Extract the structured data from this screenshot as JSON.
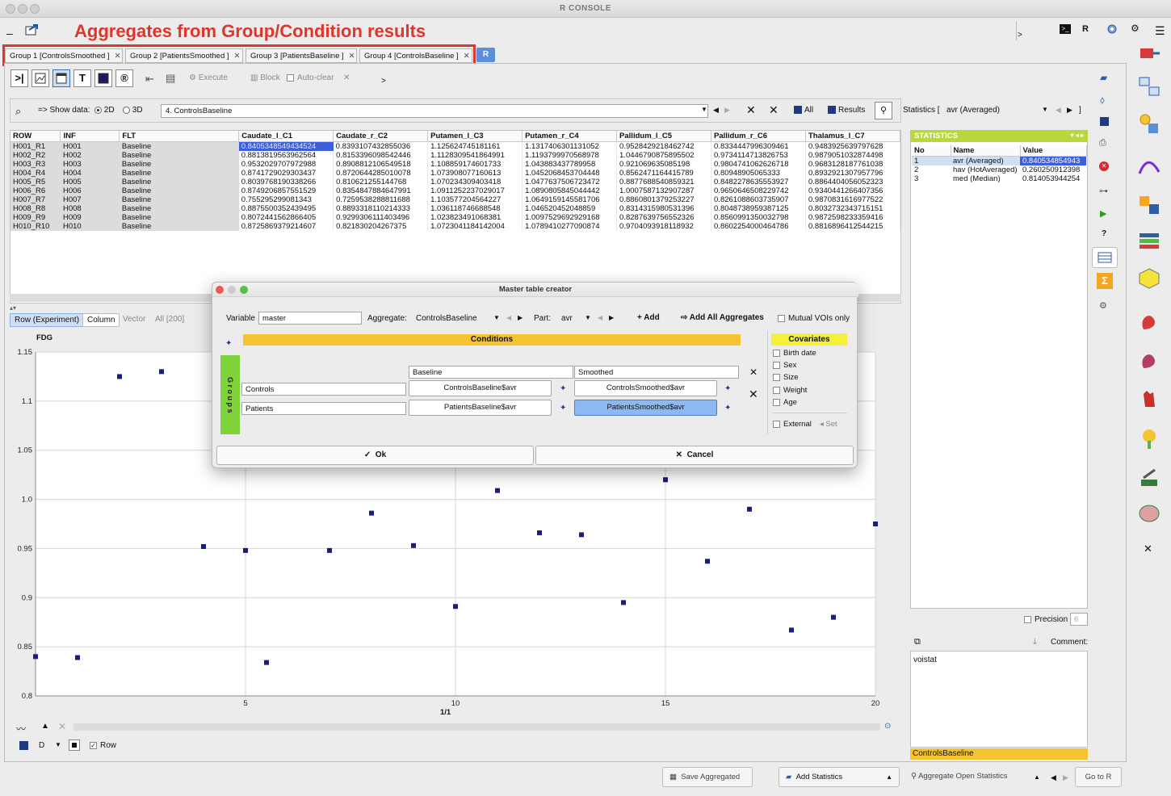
{
  "window": {
    "title": "R CONSOLE"
  },
  "annotation": "Aggregates from Group/Condition results",
  "tabs": [
    {
      "label": "Group 1 [ControlsSmoothed ]"
    },
    {
      "label": "Group 2 [PatientsSmoothed ]"
    },
    {
      "label": "Group 3 [PatientsBaseline ]"
    },
    {
      "label": "Group 4 [ControlsBaseline ]"
    }
  ],
  "r_tab": "R",
  "top_right": {
    "r_label": "R"
  },
  "toolbar": {
    "execute": "Execute",
    "block": "Block",
    "auto_clear": "Auto-clear"
  },
  "show_data": {
    "label": "=> Show data:",
    "opt_2d": "2D",
    "opt_3d": "3D",
    "selected": "4. ControlsBaseline",
    "all": "All",
    "results": "Results",
    "statistics_label": "Statistics [",
    "statistics_value": "avr (Averaged)",
    "bracket_close": "]"
  },
  "table": {
    "headers": [
      "ROW",
      "INF",
      "FLT",
      "Caudate_l_C1",
      "Caudate_r_C2",
      "Putamen_l_C3",
      "Putamen_r_C4",
      "Pallidum_l_C5",
      "Pallidum_r_C6",
      "Thalamus_l_C7"
    ],
    "rows": [
      [
        "H001_R1",
        "H001",
        "Baseline",
        "0.8405348549434524",
        "0.8393107432855036",
        "1.125624745181161",
        "1.1317406301131052",
        "0.9528429218462742",
        "0.8334447996309461",
        "0.9483925639797628"
      ],
      [
        "H002_R2",
        "H002",
        "Baseline",
        "0.8813819563962564",
        "0.8153396098542446",
        "1.1128309541864991",
        "1.1193799970568978",
        "1.0446790875895502",
        "0.9734114713826753",
        "0.9879051032874498"
      ],
      [
        "H003_R3",
        "H003",
        "Baseline",
        "0.9532029707972988",
        "0.8908812106549518",
        "1.108859174601733",
        "1.043883437789958",
        "0.921069635085198",
        "0.9804741062626718",
        "0.9683128187761038"
      ],
      [
        "H004_R4",
        "H004",
        "Baseline",
        "0.8741729029303437",
        "0.8720644285010078",
        "1.073908077160613",
        "1.0452068453704448",
        "0.8562471164415789",
        "0.80948905065333",
        "0.8932921307957796"
      ],
      [
        "H005_R5",
        "H005",
        "Baseline",
        "0.8039768190338266",
        "0.810621255144768",
        "1.070234309403418",
        "1.0477637506723472",
        "0.8877688540859321",
        "0.8482278635553927",
        "0.8864404056052323"
      ],
      [
        "H006_R6",
        "H006",
        "Baseline",
        "0.8749206857551529",
        "0.8354847884647991",
        "1.0911252237029017",
        "1.0890805845044442",
        "1.0007587132907287",
        "0.9650646508229742",
        "0.9340441266407356"
      ],
      [
        "H007_R7",
        "H007",
        "Baseline",
        "0.755295299081343",
        "0.7259538288811688",
        "1.103577204564227",
        "1.0649159145581706",
        "0.8860801379253227",
        "0.8261088603735907",
        "0.9870831616977522"
      ],
      [
        "H008_R8",
        "H008",
        "Baseline",
        "0.8875500352439495",
        "0.8893318110214333",
        "1.036118746688548",
        "1.046520452048859",
        "0.8314315980531396",
        "0.8048738959387125",
        "0.8032732343715151"
      ],
      [
        "H009_R9",
        "H009",
        "Baseline",
        "0.8072441562866405",
        "0.9299306111403496",
        "1.023823491068381",
        "1.0097529692929168",
        "0.8287639756552326",
        "0.8560991350032798",
        "0.9872598233359416"
      ],
      [
        "H010_R10",
        "H010",
        "Baseline",
        "0.8725869379214607",
        "0.821830204267375",
        "1.0723041184142004",
        "1.0789410277090874",
        "0.9704093918118932",
        "0.8602254000464786",
        "0.8816896412544215"
      ]
    ]
  },
  "statistics": {
    "title": "STATISTICS",
    "headers": [
      "No",
      "Name",
      "Value"
    ],
    "rows": [
      [
        "1",
        "avr (Averaged)",
        "0.840534854943"
      ],
      [
        "2",
        "hav (HotAveraged)",
        "0.260250912398"
      ],
      [
        "3",
        "med (Median)",
        "0.814053944254"
      ]
    ],
    "precision_label": "Precision",
    "precision_value": "6",
    "comment_label": "Comment:",
    "comment_text": "voistat",
    "footer": "ControlsBaseline"
  },
  "plot_tabs": [
    "Row (Experiment)",
    "Column",
    "Vector",
    "All [200]"
  ],
  "plot_bottom": {
    "d_label": "D",
    "row_label": "Row"
  },
  "chart_data": {
    "type": "scatter",
    "ylabel": "FDG",
    "xlabel": "1/1",
    "xlim": [
      0,
      20
    ],
    "ylim": [
      0.8,
      1.15
    ],
    "yticks": [
      "1.15",
      "1.1",
      "1.05",
      "1.0",
      "0.95",
      "0.9",
      "0.85",
      "0.8"
    ],
    "ytick_values": [
      1.15,
      1.1,
      1.05,
      1.0,
      0.95,
      0.9,
      0.85,
      0.8
    ],
    "xticks": [
      "5",
      "10",
      "15",
      "20"
    ],
    "xtick_values": [
      5,
      10,
      15,
      20
    ],
    "points": [
      [
        0,
        0.84
      ],
      [
        1,
        0.839
      ],
      [
        2,
        1.125
      ],
      [
        3,
        1.13
      ],
      [
        4,
        0.952
      ],
      [
        5,
        0.948
      ],
      [
        5.5,
        0.834
      ],
      [
        7,
        0.948
      ],
      [
        8,
        0.986
      ],
      [
        9,
        0.953
      ],
      [
        10,
        0.891
      ],
      [
        11,
        1.009
      ],
      [
        12,
        0.966
      ],
      [
        13,
        0.964
      ],
      [
        14,
        0.895
      ],
      [
        15,
        1.02
      ],
      [
        16,
        0.937
      ],
      [
        17,
        0.99
      ],
      [
        18,
        0.867
      ],
      [
        19,
        0.88
      ],
      [
        20,
        0.975
      ]
    ],
    "point_color": "#1c1c7a"
  },
  "dialog": {
    "title": "Master table creator",
    "variable_label": "Variable",
    "variable_value": "master",
    "aggregate_label": "Aggregate:",
    "aggregate_value": "ControlsBaseline",
    "part_label": "Part:",
    "part_value": "avr",
    "add": "Add",
    "add_all": "Add All Aggregates",
    "mutual": "Mutual VOIs only",
    "conditions_title": "Conditions",
    "groups_title": "G r o u p s",
    "cond1": "Baseline",
    "cond2": "Smoothed",
    "group1": "Controls",
    "group2": "Patients",
    "cell_11": "ControlsBaseline$avr",
    "cell_12": "ControlsSmoothed$avr",
    "cell_21": "PatientsBaseline$avr",
    "cell_22": "PatientsSmoothed$avr",
    "covariates_title": "Covariates",
    "covariates": [
      "Birth date",
      "Sex",
      "Size",
      "Weight",
      "Age"
    ],
    "external": "External",
    "set": "Set",
    "ok": "Ok",
    "cancel": "Cancel"
  },
  "status_bar": {
    "save_aggregated": "Save Aggregated",
    "add_statistics": "Add Statistics",
    "aggregate_open": "Aggregate Open Statistics",
    "go_to_r": "Go to R"
  }
}
